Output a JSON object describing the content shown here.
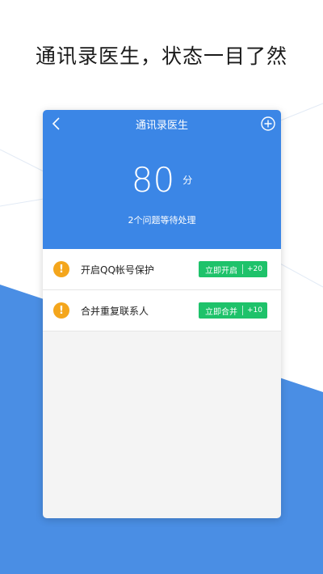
{
  "headline": "通讯录医生，状态一目了然",
  "navbar": {
    "title": "通讯录医生",
    "back_icon": "chevron-left-icon",
    "add_icon": "plus-circle-icon"
  },
  "score": {
    "value": "80",
    "unit": "分",
    "issue_summary": "2个问题等待处理"
  },
  "issues": [
    {
      "label": "开启QQ帐号保护",
      "action": "立即开启",
      "points": "+20"
    },
    {
      "label": "合并重复联系人",
      "action": "立即合并",
      "points": "+10"
    }
  ],
  "colors": {
    "header_blue": "#3b86e6",
    "background_blue": "#4a8ee4",
    "action_green": "#1ec26a",
    "warning_orange": "#f4a61c"
  }
}
